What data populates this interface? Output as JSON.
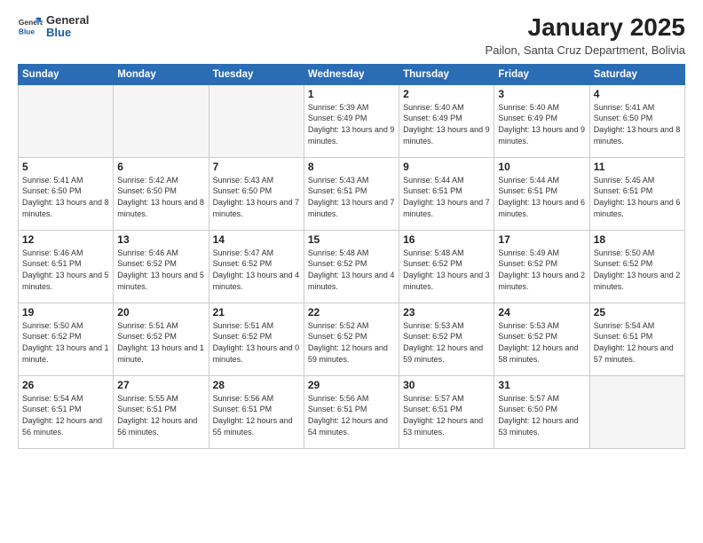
{
  "header": {
    "logo_general": "General",
    "logo_blue": "Blue",
    "month_year": "January 2025",
    "location": "Pailon, Santa Cruz Department, Bolivia"
  },
  "weekdays": [
    "Sunday",
    "Monday",
    "Tuesday",
    "Wednesday",
    "Thursday",
    "Friday",
    "Saturday"
  ],
  "weeks": [
    [
      {
        "day": "",
        "empty": true
      },
      {
        "day": "",
        "empty": true
      },
      {
        "day": "",
        "empty": true
      },
      {
        "day": "1",
        "sunrise": "5:39 AM",
        "sunset": "6:49 PM",
        "daylight": "13 hours and 9 minutes."
      },
      {
        "day": "2",
        "sunrise": "5:40 AM",
        "sunset": "6:49 PM",
        "daylight": "13 hours and 9 minutes."
      },
      {
        "day": "3",
        "sunrise": "5:40 AM",
        "sunset": "6:49 PM",
        "daylight": "13 hours and 9 minutes."
      },
      {
        "day": "4",
        "sunrise": "5:41 AM",
        "sunset": "6:50 PM",
        "daylight": "13 hours and 8 minutes."
      }
    ],
    [
      {
        "day": "5",
        "sunrise": "5:41 AM",
        "sunset": "6:50 PM",
        "daylight": "13 hours and 8 minutes."
      },
      {
        "day": "6",
        "sunrise": "5:42 AM",
        "sunset": "6:50 PM",
        "daylight": "13 hours and 8 minutes."
      },
      {
        "day": "7",
        "sunrise": "5:43 AM",
        "sunset": "6:50 PM",
        "daylight": "13 hours and 7 minutes."
      },
      {
        "day": "8",
        "sunrise": "5:43 AM",
        "sunset": "6:51 PM",
        "daylight": "13 hours and 7 minutes."
      },
      {
        "day": "9",
        "sunrise": "5:44 AM",
        "sunset": "6:51 PM",
        "daylight": "13 hours and 7 minutes."
      },
      {
        "day": "10",
        "sunrise": "5:44 AM",
        "sunset": "6:51 PM",
        "daylight": "13 hours and 6 minutes."
      },
      {
        "day": "11",
        "sunrise": "5:45 AM",
        "sunset": "6:51 PM",
        "daylight": "13 hours and 6 minutes."
      }
    ],
    [
      {
        "day": "12",
        "sunrise": "5:46 AM",
        "sunset": "6:51 PM",
        "daylight": "13 hours and 5 minutes."
      },
      {
        "day": "13",
        "sunrise": "5:46 AM",
        "sunset": "6:52 PM",
        "daylight": "13 hours and 5 minutes."
      },
      {
        "day": "14",
        "sunrise": "5:47 AM",
        "sunset": "6:52 PM",
        "daylight": "13 hours and 4 minutes."
      },
      {
        "day": "15",
        "sunrise": "5:48 AM",
        "sunset": "6:52 PM",
        "daylight": "13 hours and 4 minutes."
      },
      {
        "day": "16",
        "sunrise": "5:48 AM",
        "sunset": "6:52 PM",
        "daylight": "13 hours and 3 minutes."
      },
      {
        "day": "17",
        "sunrise": "5:49 AM",
        "sunset": "6:52 PM",
        "daylight": "13 hours and 2 minutes."
      },
      {
        "day": "18",
        "sunrise": "5:50 AM",
        "sunset": "6:52 PM",
        "daylight": "13 hours and 2 minutes."
      }
    ],
    [
      {
        "day": "19",
        "sunrise": "5:50 AM",
        "sunset": "6:52 PM",
        "daylight": "13 hours and 1 minute."
      },
      {
        "day": "20",
        "sunrise": "5:51 AM",
        "sunset": "6:52 PM",
        "daylight": "13 hours and 1 minute."
      },
      {
        "day": "21",
        "sunrise": "5:51 AM",
        "sunset": "6:52 PM",
        "daylight": "13 hours and 0 minutes."
      },
      {
        "day": "22",
        "sunrise": "5:52 AM",
        "sunset": "6:52 PM",
        "daylight": "12 hours and 59 minutes."
      },
      {
        "day": "23",
        "sunrise": "5:53 AM",
        "sunset": "6:52 PM",
        "daylight": "12 hours and 59 minutes."
      },
      {
        "day": "24",
        "sunrise": "5:53 AM",
        "sunset": "6:52 PM",
        "daylight": "12 hours and 58 minutes."
      },
      {
        "day": "25",
        "sunrise": "5:54 AM",
        "sunset": "6:51 PM",
        "daylight": "12 hours and 57 minutes."
      }
    ],
    [
      {
        "day": "26",
        "sunrise": "5:54 AM",
        "sunset": "6:51 PM",
        "daylight": "12 hours and 56 minutes."
      },
      {
        "day": "27",
        "sunrise": "5:55 AM",
        "sunset": "6:51 PM",
        "daylight": "12 hours and 56 minutes."
      },
      {
        "day": "28",
        "sunrise": "5:56 AM",
        "sunset": "6:51 PM",
        "daylight": "12 hours and 55 minutes."
      },
      {
        "day": "29",
        "sunrise": "5:56 AM",
        "sunset": "6:51 PM",
        "daylight": "12 hours and 54 minutes."
      },
      {
        "day": "30",
        "sunrise": "5:57 AM",
        "sunset": "6:51 PM",
        "daylight": "12 hours and 53 minutes."
      },
      {
        "day": "31",
        "sunrise": "5:57 AM",
        "sunset": "6:50 PM",
        "daylight": "12 hours and 53 minutes."
      },
      {
        "day": "",
        "empty": true
      }
    ]
  ],
  "labels": {
    "sunrise": "Sunrise:",
    "sunset": "Sunset:",
    "daylight": "Daylight:"
  }
}
